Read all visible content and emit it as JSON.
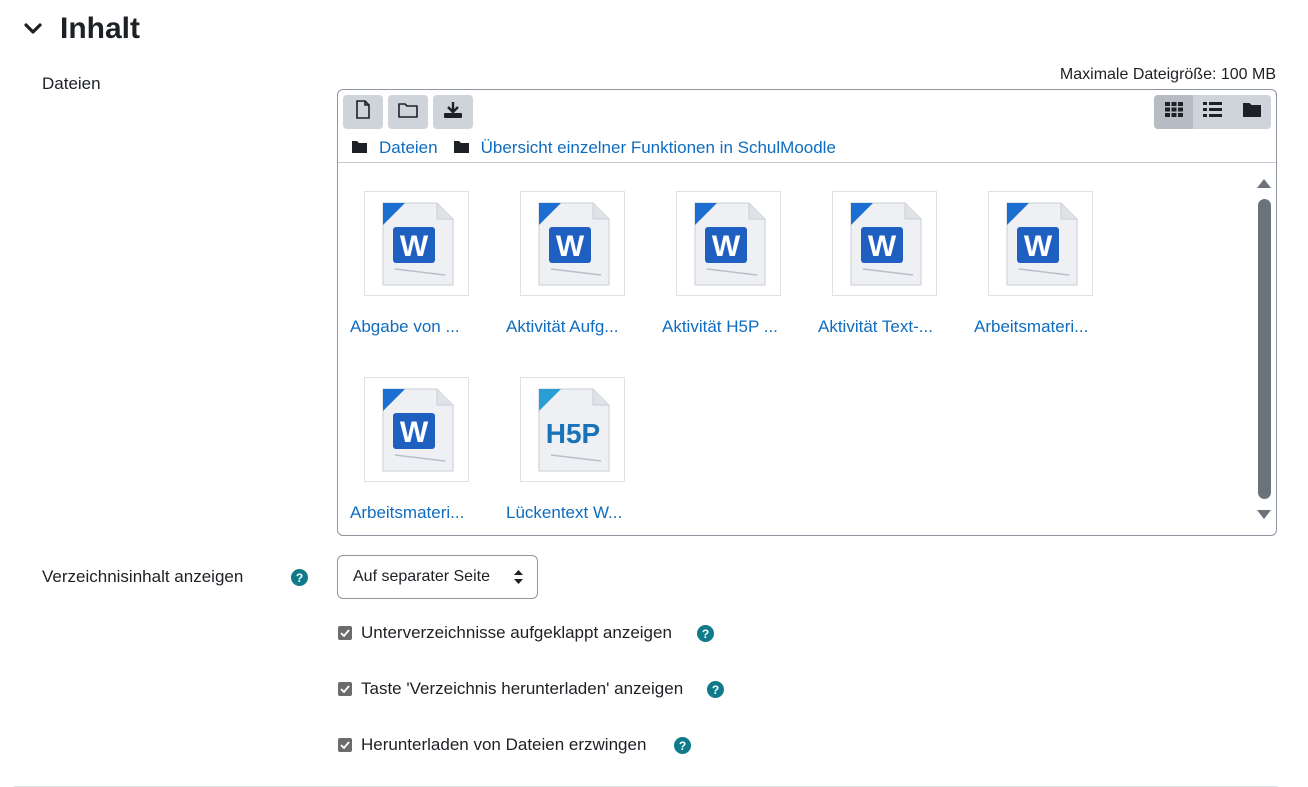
{
  "section": {
    "title": "Inhalt",
    "toggle_icon": "chevron-down-icon"
  },
  "files_field": {
    "label": "Dateien",
    "max_size": "Maximale Dateigröße: 100 MB",
    "toolbar": {
      "add_icon": "file-icon",
      "mkdir_icon": "folder-icon",
      "download_icon": "download-icon"
    },
    "views": [
      {
        "icon": "grid-view-icon",
        "active": true
      },
      {
        "icon": "list-view-icon",
        "active": false
      },
      {
        "icon": "tree-view-icon",
        "active": false
      }
    ],
    "breadcrumb": [
      "Dateien",
      "Übersicht einzelner Funktionen in SchulMoodle"
    ],
    "files": [
      {
        "name": "Abgabe von ...",
        "type": "word"
      },
      {
        "name": "Aktivität Aufg...",
        "type": "word"
      },
      {
        "name": "Aktivität H5P ...",
        "type": "word"
      },
      {
        "name": "Aktivität Text-...",
        "type": "word"
      },
      {
        "name": "Arbeitsmateri...",
        "type": "word"
      },
      {
        "name": "Arbeitsmateri...",
        "type": "word"
      },
      {
        "name": "Lückentext W...",
        "type": "h5p"
      }
    ],
    "icon_texts": {
      "word": "W",
      "h5p": "H5P"
    }
  },
  "display": {
    "label": "Verzeichnisinhalt anzeigen",
    "value": "Auf separater Seite"
  },
  "options": [
    {
      "label": "Unterverzeichnisse aufgeklappt anzeigen",
      "checked": true
    },
    {
      "label": "Taste 'Verzeichnis herunterladen' anzeigen",
      "checked": true
    },
    {
      "label": "Herunterladen von Dateien erzwingen",
      "checked": true
    }
  ],
  "help_glyph": "?",
  "colors": {
    "link": "#0f6cbf",
    "help": "#0f7b8a",
    "word_blue": "#1e5fc0",
    "h5p_blue": "#1a73b8"
  }
}
